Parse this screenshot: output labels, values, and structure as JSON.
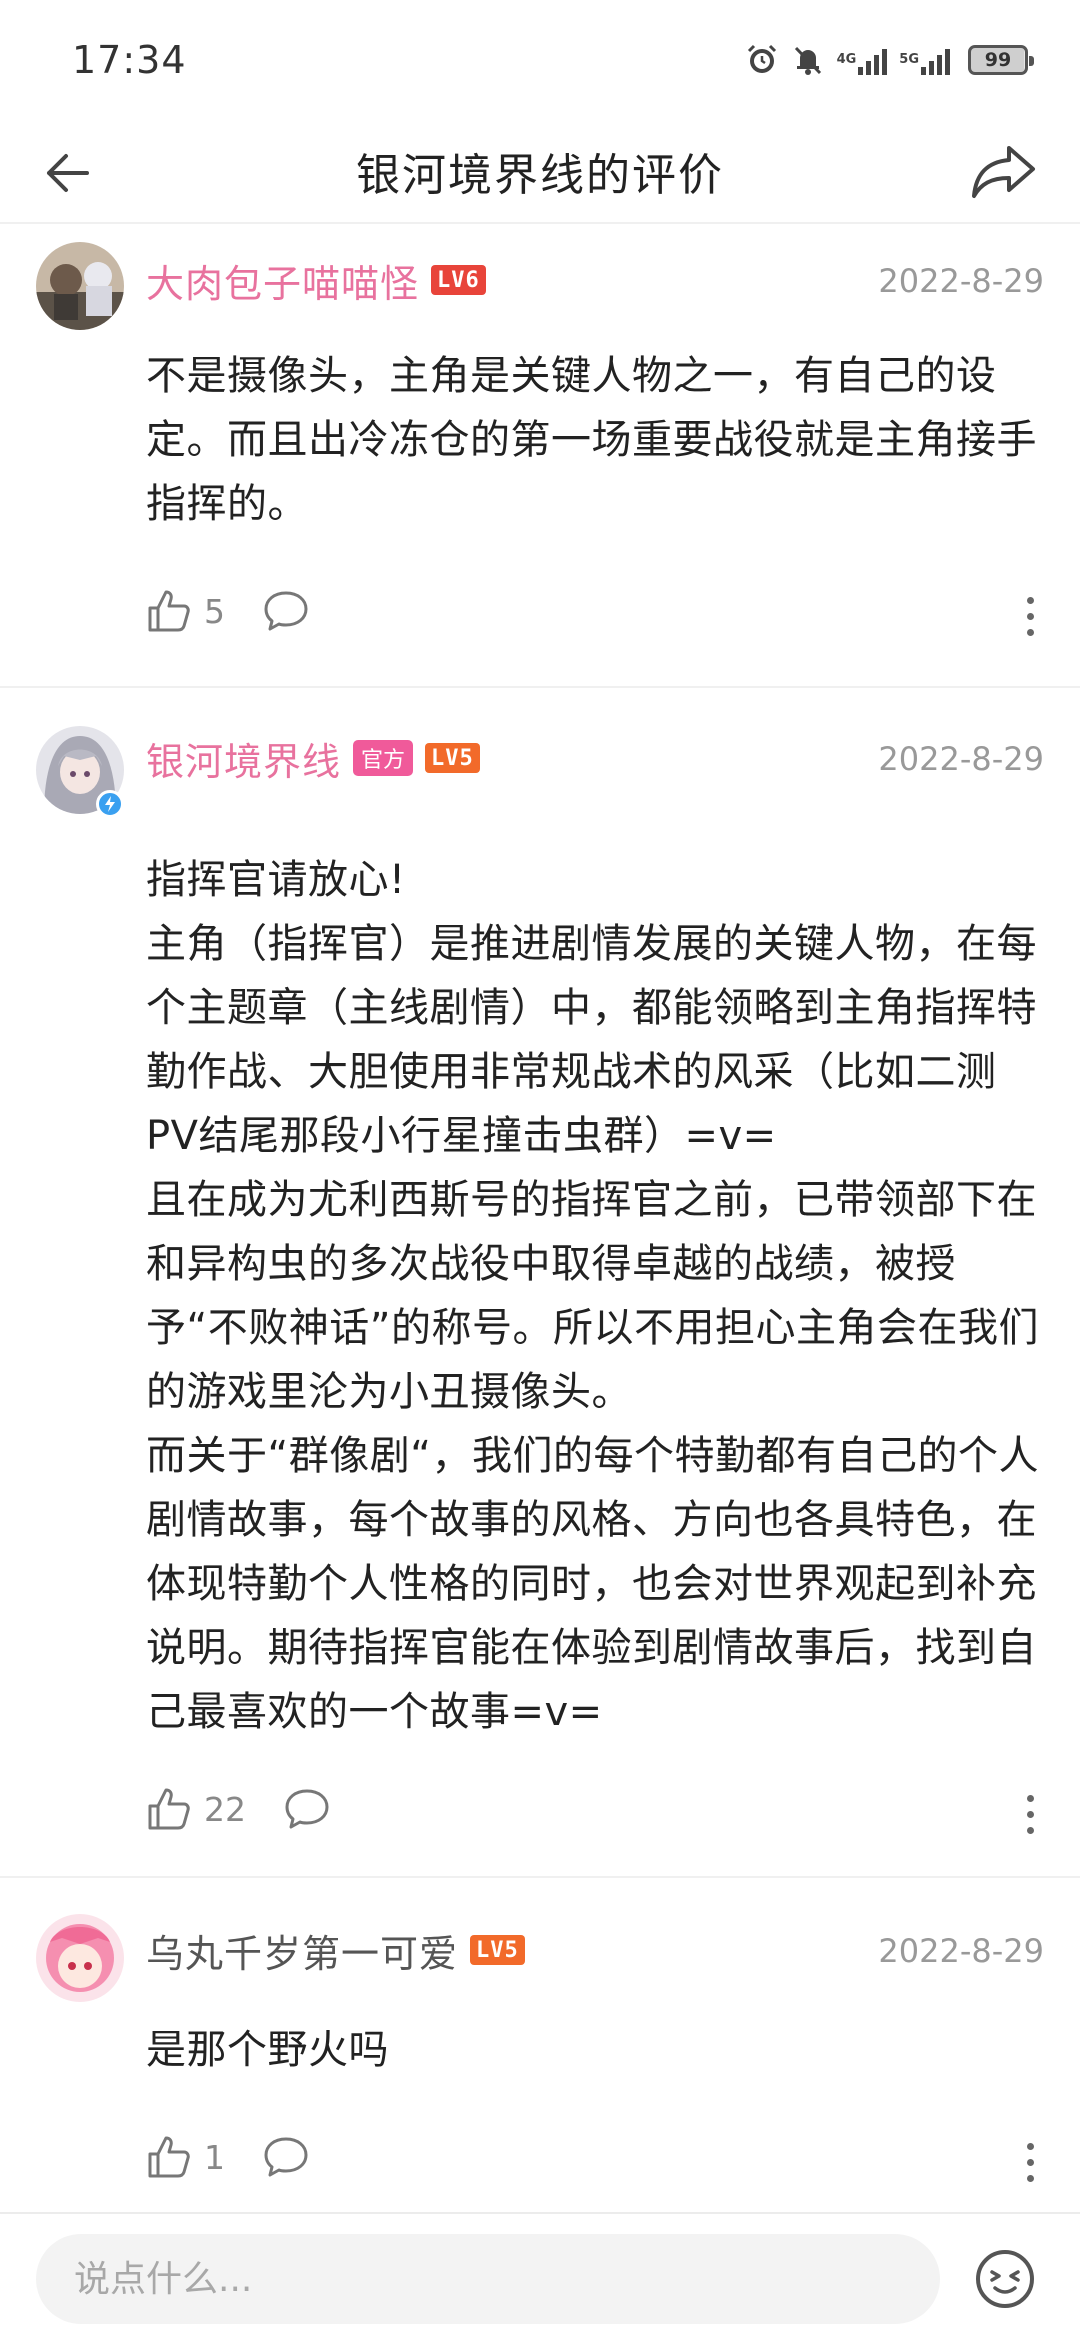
{
  "status_bar": {
    "time": "17:34",
    "net1": "4G",
    "net2": "5G",
    "battery": "99"
  },
  "header": {
    "title": "银河境界线的评价"
  },
  "comments": [
    {
      "username": "大肉包子喵喵怪",
      "level": "LV6",
      "date": "2022-8-29",
      "text": "不是摄像头，主角是关键人物之一，有自己的设定。而且出冷冻仓的第一场重要战役就是主角接手指挥的。",
      "likes": "5"
    },
    {
      "username": "银河境界线",
      "official": "官方",
      "level": "LV5",
      "date": "2022-8-29",
      "text": "指挥官请放心!\n主角（指挥官）是推进剧情发展的关键人物，在每个主题章（主线剧情）中，都能领略到主角指挥特勤作战、大胆使用非常规战术的风采（比如二测PV结尾那段小行星撞击虫群）=v=\n且在成为尤利西斯号的指挥官之前，已带领部下在和异构虫的多次战役中取得卓越的战绩，被授予“不败神话”的称号。所以不用担心主角会在我们的游戏里沦为小丑摄像头。\n而关于“群像剧“，我们的每个特勤都有自己的个人剧情故事，每个故事的风格、方向也各具特色，在体现特勤个人性格的同时，也会对世界观起到补充说明。期待指挥官能在体验到剧情故事后，找到自己最喜欢的一个故事=v=",
      "likes": "22"
    },
    {
      "username": "乌丸千岁第一可爱",
      "level": "LV5",
      "date": "2022-8-29",
      "text": "是那个野火吗",
      "likes": "1"
    }
  ],
  "bottom": {
    "placeholder": "说点什么..."
  },
  "colors": {
    "accent_pink": "#e8729e",
    "level_orange": "#f26a2a",
    "official_pink": "#f05a9a"
  }
}
